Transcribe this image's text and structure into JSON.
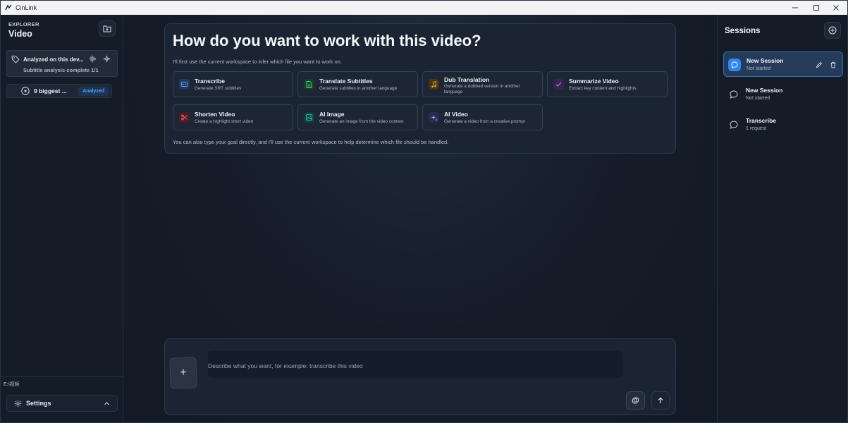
{
  "window": {
    "title": "CinLink",
    "controls": [
      "minimize",
      "maximize",
      "close"
    ]
  },
  "explorer": {
    "label": "EXPLORER",
    "title": "Video",
    "file_card": {
      "name": "Analyzed on this dev...",
      "status": "Subtitle analysis complete 1/1"
    },
    "video_item": {
      "name": "9 biggest ...",
      "badge": "Analyzed",
      "badge_color": "#4da0ff"
    },
    "path": "E:\\视频",
    "settings_label": "Settings"
  },
  "main": {
    "heading": "How do you want to work with this video?",
    "subtitle": "I'll first use the current workspace to infer which file you want to work on.",
    "options": [
      {
        "title": "Transcribe",
        "description": "Generate SRT subtitles",
        "icon": "subtitles-icon",
        "color": "#3b82f6"
      },
      {
        "title": "Translate Subtitles",
        "description": "Generate subtitles in another language",
        "icon": "document-icon",
        "color": "#22c55e"
      },
      {
        "title": "Dub Translation",
        "description": "Generate a dubbed version in another language",
        "icon": "music-note-icon",
        "color": "#f59e0b"
      },
      {
        "title": "Summarize Video",
        "description": "Extract key content and highlights",
        "icon": "checkmark-icon",
        "color": "#a855f7"
      },
      {
        "title": "Shorten Video",
        "description": "Create a highlight short video",
        "icon": "scissors-icon",
        "color": "#ef4444"
      },
      {
        "title": "AI Image",
        "description": "Generate an image from the video context",
        "icon": "image-icon",
        "color": "#14b8a6"
      },
      {
        "title": "AI Video",
        "description": "Generate a video from a creative prompt",
        "icon": "sparkles-icon",
        "color": "#818cf8"
      }
    ],
    "hint": "You can also type your goal directly, and I'll use the current workspace to help determine which file should be handled."
  },
  "composer": {
    "placeholder": "Describe what you want, for example: transcribe this video",
    "attach_label": "+",
    "mention_label": "@"
  },
  "sessions": {
    "title": "Sessions",
    "items": [
      {
        "title": "New Session",
        "subtitle": "Not started",
        "active": true
      },
      {
        "title": "New Session",
        "subtitle": "Not started",
        "active": false
      },
      {
        "title": "Transcribe",
        "subtitle": "1 request",
        "active": false
      }
    ]
  }
}
